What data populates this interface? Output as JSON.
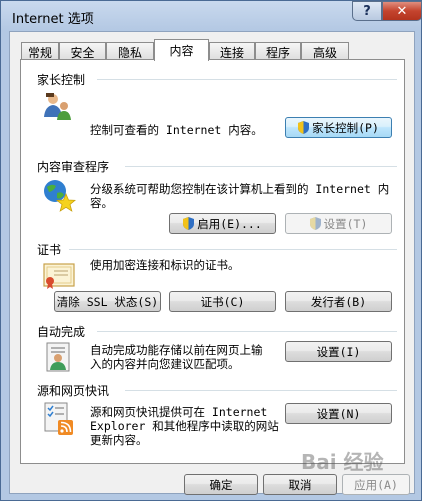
{
  "window": {
    "title": "Internet 选项",
    "help_glyph": "?",
    "close_glyph": "✕"
  },
  "tabs": [
    {
      "label": "常规"
    },
    {
      "label": "安全"
    },
    {
      "label": "隐私"
    },
    {
      "label": "内容",
      "active": true
    },
    {
      "label": "连接"
    },
    {
      "label": "程序"
    },
    {
      "label": "高级"
    }
  ],
  "parental": {
    "title": "家长控制",
    "description": "控制可查看的 Internet 内容。",
    "button": "家长控制(P)",
    "icon": "family-users-icon"
  },
  "advisor": {
    "title": "内容审查程序",
    "description_line1": "分级系统可帮助您控制在该计算机上看到的 Internet 内",
    "description_line2": "容。",
    "enable_button": "启用(E)...",
    "settings_button": "设置(T)",
    "icon": "globe-star-icon"
  },
  "certificates": {
    "title": "证书",
    "description": "使用加密连接和标识的证书。",
    "clear_ssl_button": "清除 SSL 状态(S)",
    "certs_button": "证书(C)",
    "publishers_button": "发行者(B)",
    "icon": "certificate-icon"
  },
  "autocomplete": {
    "title": "自动完成",
    "description_line1": "自动完成功能存储以前在网页上输",
    "description_line2": "入的内容并向您建议匹配项。",
    "settings_button": "设置(I)",
    "icon": "autocomplete-form-icon"
  },
  "feeds": {
    "title": "源和网页快讯",
    "description_line1": "源和网页快讯提供可在 Internet",
    "description_line2": "Explorer 和其他程序中读取的网站",
    "description_line3": "更新内容。",
    "settings_button": "设置(N)",
    "icon": "rss-feed-icon"
  },
  "footer": {
    "ok": "确定",
    "cancel": "取消",
    "apply": "应用(A)"
  },
  "watermark": "Bai 经验",
  "colors": {
    "accent_focus": "#3c7fb1",
    "close_red": "#c4442e",
    "rss_orange": "#f08a24"
  }
}
